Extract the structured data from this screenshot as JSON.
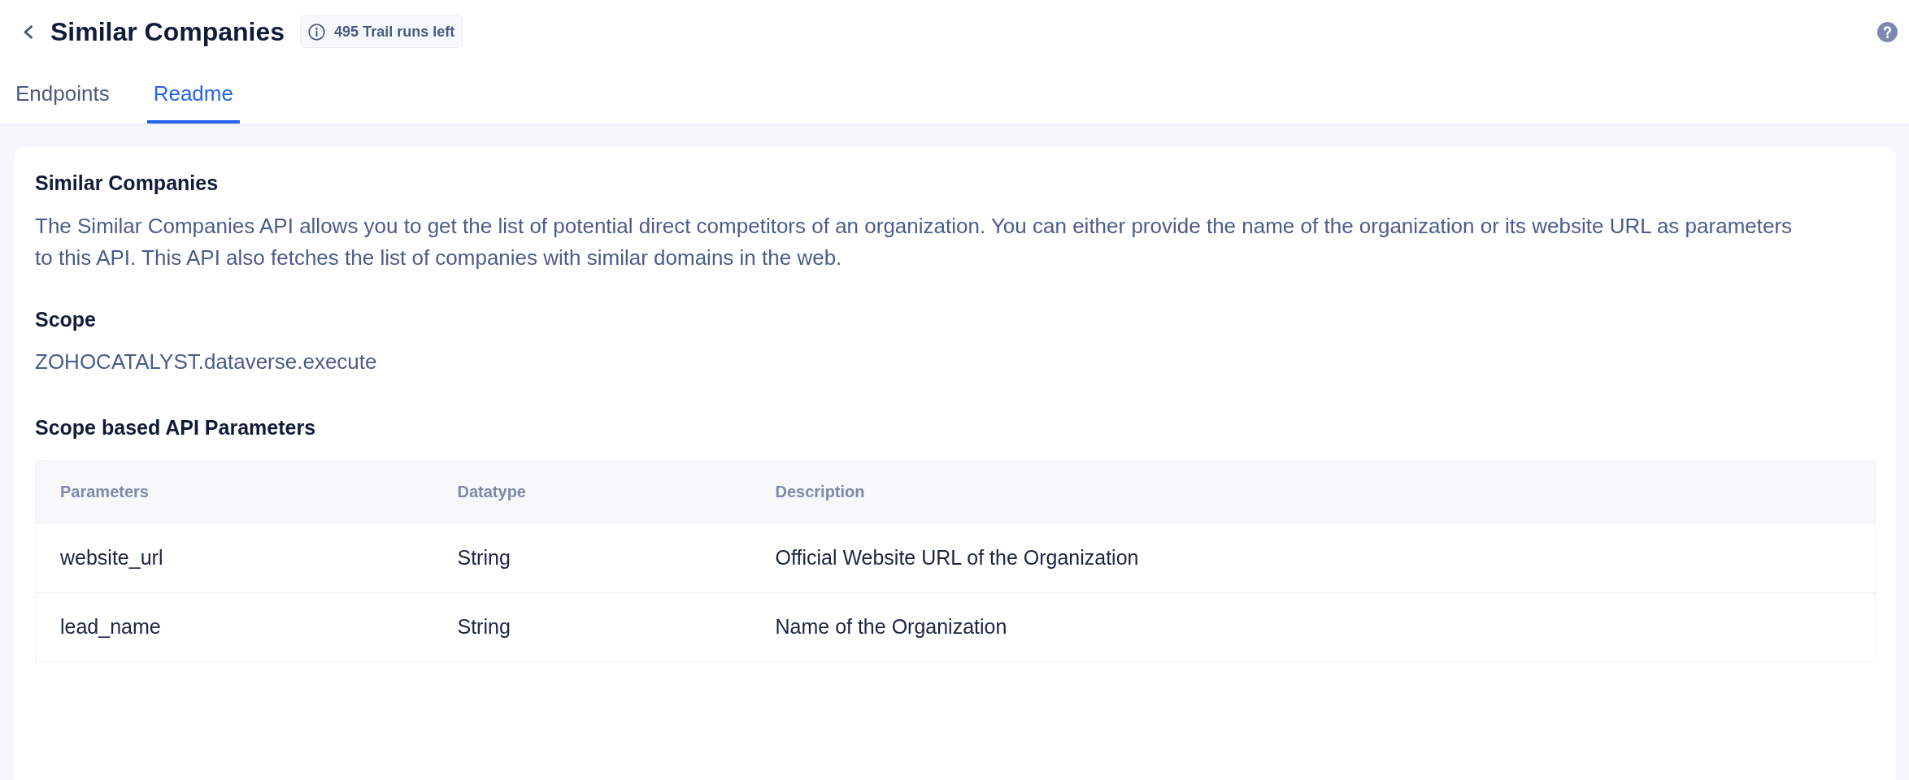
{
  "header": {
    "title": "Similar Companies",
    "badge": "495 Trail runs left"
  },
  "tabs": [
    {
      "label": "Endpoints",
      "selected": false
    },
    {
      "label": "Readme",
      "selected": true
    }
  ],
  "readme": {
    "title": "Similar Companies",
    "description": "The Similar Companies API allows you to get the list of potential direct competitors of an organization. You can either provide the name of the organization or its website URL as parameters to this API. This API also fetches the list of companies with similar domains in the web.",
    "scope_heading": "Scope",
    "scope": "ZOHOCATALYST.dataverse.execute",
    "parameters_heading": "Scope based API Parameters",
    "table": {
      "columns": [
        "Parameters",
        "Datatype",
        "Description"
      ],
      "rows": [
        [
          "website_url",
          "String",
          "Official Website URL of the Organization"
        ],
        [
          "lead_name",
          "String",
          "Name of the Organization"
        ]
      ]
    }
  }
}
